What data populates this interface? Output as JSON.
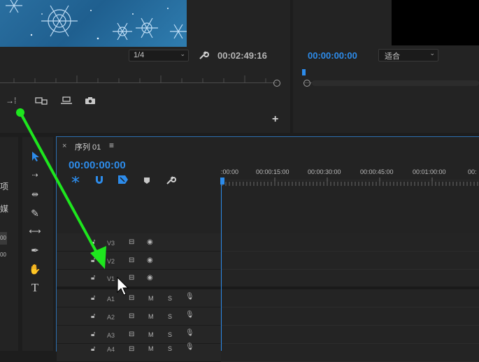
{
  "source_monitor": {
    "zoom_select": "1/4",
    "timecode": "00:02:49:16",
    "buttons": [
      "insert-icon",
      "overwrite-icon",
      "lift-icon",
      "extract-icon",
      "camera-icon"
    ],
    "add_label": "+"
  },
  "program_monitor": {
    "timecode": "00:00:00:00",
    "fit_select": "适合"
  },
  "left_panel": {
    "partial_labels": [
      "项",
      "媒",
      "00",
      "00"
    ]
  },
  "timeline": {
    "close_label": "×",
    "title": "序列 01",
    "menu_label": "≡",
    "timecode": "00:00:00:00",
    "ruler_labels": [
      ":00:00",
      "00:00:15:00",
      "00:00:30:00",
      "00:00:45:00",
      "00:01:00:00",
      "00:"
    ],
    "video_tracks": [
      {
        "name": "V3"
      },
      {
        "name": "V2"
      },
      {
        "name": "V1"
      }
    ],
    "audio_tracks": [
      {
        "name": "A1",
        "m": "M",
        "s": "S"
      },
      {
        "name": "A2",
        "m": "M",
        "s": "S"
      },
      {
        "name": "A3",
        "m": "M",
        "s": "S"
      },
      {
        "name": "A4",
        "m": "M",
        "s": "S"
      }
    ]
  },
  "colors": {
    "accent": "#2d8ceb",
    "annotation_arrow": "#1ee61e",
    "background": "#1d1d1d"
  }
}
